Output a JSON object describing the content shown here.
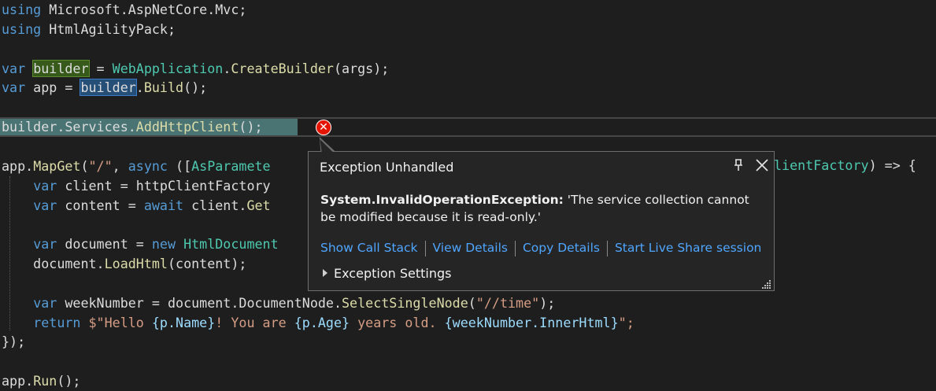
{
  "editor": {
    "lines": [
      {
        "tokens": [
          {
            "t": "using",
            "c": "kw"
          },
          {
            "t": " Microsoft.AspNetCore.Mvc;",
            "c": "pl"
          }
        ]
      },
      {
        "tokens": [
          {
            "t": "using",
            "c": "kw"
          },
          {
            "t": " HtmlAgilityPack;",
            "c": "pl"
          }
        ]
      },
      {
        "tokens": []
      },
      {
        "tokens": [
          {
            "t": "var",
            "c": "kw"
          },
          {
            "t": " ",
            "c": "pl"
          },
          {
            "t": "builder",
            "c": "pl",
            "h": "green"
          },
          {
            "t": " = ",
            "c": "pl"
          },
          {
            "t": "WebApplication",
            "c": "ty"
          },
          {
            "t": ".",
            "c": "pl"
          },
          {
            "t": "CreateBuilder",
            "c": "fn"
          },
          {
            "t": "(args);",
            "c": "pl"
          }
        ]
      },
      {
        "tokens": [
          {
            "t": "var",
            "c": "kw"
          },
          {
            "t": " app = ",
            "c": "pl"
          },
          {
            "t": "builder",
            "c": "pl",
            "h": "blue"
          },
          {
            "t": ".",
            "c": "pl"
          },
          {
            "t": "Build",
            "c": "fn"
          },
          {
            "t": "();",
            "c": "pl"
          }
        ]
      },
      {
        "tokens": []
      },
      {
        "tokens": [
          {
            "t": "builder.Services.",
            "c": "pl"
          },
          {
            "t": "AddHttpClient",
            "c": "fn"
          },
          {
            "t": "();",
            "c": "pl"
          }
        ]
      },
      {
        "tokens": []
      },
      {
        "tokens": [
          {
            "t": "app.",
            "c": "pl"
          },
          {
            "t": "MapGet",
            "c": "fn"
          },
          {
            "t": "(",
            "c": "pl"
          },
          {
            "t": "\"/\"",
            "c": "st"
          },
          {
            "t": ", ",
            "c": "pl"
          },
          {
            "t": "async",
            "c": "kw"
          },
          {
            "t": " ([",
            "c": "pl"
          },
          {
            "t": "AsParamete",
            "c": "ty"
          }
        ]
      },
      {
        "tokens": [
          {
            "t": "    ",
            "c": "pl"
          },
          {
            "t": "var",
            "c": "kw"
          },
          {
            "t": " client = httpClientFactory",
            "c": "pl"
          }
        ]
      },
      {
        "tokens": [
          {
            "t": "    ",
            "c": "pl"
          },
          {
            "t": "var",
            "c": "kw"
          },
          {
            "t": " content = ",
            "c": "pl"
          },
          {
            "t": "await",
            "c": "kw"
          },
          {
            "t": " client.",
            "c": "pl"
          },
          {
            "t": "Get",
            "c": "fn"
          }
        ]
      },
      {
        "tokens": []
      },
      {
        "tokens": [
          {
            "t": "    ",
            "c": "pl"
          },
          {
            "t": "var",
            "c": "kw"
          },
          {
            "t": " document = ",
            "c": "pl"
          },
          {
            "t": "new",
            "c": "kw"
          },
          {
            "t": " ",
            "c": "pl"
          },
          {
            "t": "HtmlDocument",
            "c": "ty"
          }
        ]
      },
      {
        "tokens": [
          {
            "t": "    document.",
            "c": "pl"
          },
          {
            "t": "LoadHtml",
            "c": "fn"
          },
          {
            "t": "(content);",
            "c": "pl"
          }
        ]
      },
      {
        "tokens": []
      },
      {
        "tokens": [
          {
            "t": "    ",
            "c": "pl"
          },
          {
            "t": "var",
            "c": "kw"
          },
          {
            "t": " weekNumber = document.DocumentNode.",
            "c": "pl"
          },
          {
            "t": "SelectSingleNode",
            "c": "fn"
          },
          {
            "t": "(",
            "c": "pl"
          },
          {
            "t": "\"//time\"",
            "c": "st"
          },
          {
            "t": ");",
            "c": "pl"
          }
        ]
      },
      {
        "tokens": [
          {
            "t": "    ",
            "c": "pl"
          },
          {
            "t": "return",
            "c": "kw"
          },
          {
            "t": " ",
            "c": "pl"
          },
          {
            "t": "$\"Hello ",
            "c": "st"
          },
          {
            "t": "{p.Name}",
            "c": "ip"
          },
          {
            "t": "! You are ",
            "c": "st"
          },
          {
            "t": "{p.Age}",
            "c": "ip"
          },
          {
            "t": " years old. ",
            "c": "st"
          },
          {
            "t": "{weekNumber.InnerHtml}",
            "c": "ip"
          },
          {
            "t": "\";",
            "c": "st"
          }
        ]
      },
      {
        "tokens": [
          {
            "t": "});",
            "c": "pl"
          }
        ]
      },
      {
        "tokens": []
      },
      {
        "tokens": [
          {
            "t": "app.",
            "c": "pl"
          },
          {
            "t": "Run",
            "c": "fn"
          },
          {
            "t": "();",
            "c": "pl"
          }
        ]
      }
    ],
    "line8_tail": [
      {
        "t": "lientFactory",
        "c": "ty"
      },
      {
        "t": ") => {",
        "c": "pl"
      }
    ]
  },
  "exception_popup": {
    "title": "Exception Unhandled",
    "exception_type": "System.InvalidOperationException:",
    "message": "'The service collection cannot be modified because it is read-only.'",
    "links": [
      {
        "label": "Show Call Stack"
      },
      {
        "label": "View Details"
      },
      {
        "label": "Copy Details"
      },
      {
        "label": "Start Live Share session"
      }
    ],
    "settings_label": "Exception Settings",
    "pin_icon": "pin-icon",
    "close_icon": "close-icon"
  },
  "colors": {
    "background": "#1e1e1e",
    "keyword": "#569cd6",
    "type": "#4ec9b0",
    "method": "#dcdcaa",
    "string": "#d69d85",
    "link": "#4fa6ff",
    "error": "#e51400"
  }
}
